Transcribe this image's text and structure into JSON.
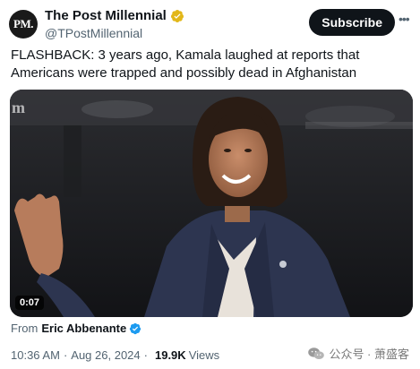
{
  "header": {
    "avatar_text": "PM.",
    "display_name": "The Post Millennial",
    "handle": "@TPostMillennial",
    "subscribe_label": "Subscribe",
    "more_icon": "ellipsis-icon",
    "verified_color": "#e2b719"
  },
  "tweet": {
    "text": "FLASHBACK: 3 years ago, Kamala laughed at reports that Americans were trapped and possibly dead in Afghanistan"
  },
  "media": {
    "duration": "0:07",
    "watermark": "m"
  },
  "attribution": {
    "from_label": "From",
    "from_name": "Eric Abbenante",
    "verified_color": "#1d9bf0"
  },
  "meta": {
    "time": "10:36 AM",
    "date": "Aug 26, 2024",
    "views_count": "19.9K",
    "views_label": "Views"
  },
  "wechat": {
    "label": "公众号 · 萧盛客"
  },
  "colors": {
    "subscribe_bg": "#0f1419",
    "secondary_text": "#536471",
    "primary_text": "#0f1419"
  }
}
